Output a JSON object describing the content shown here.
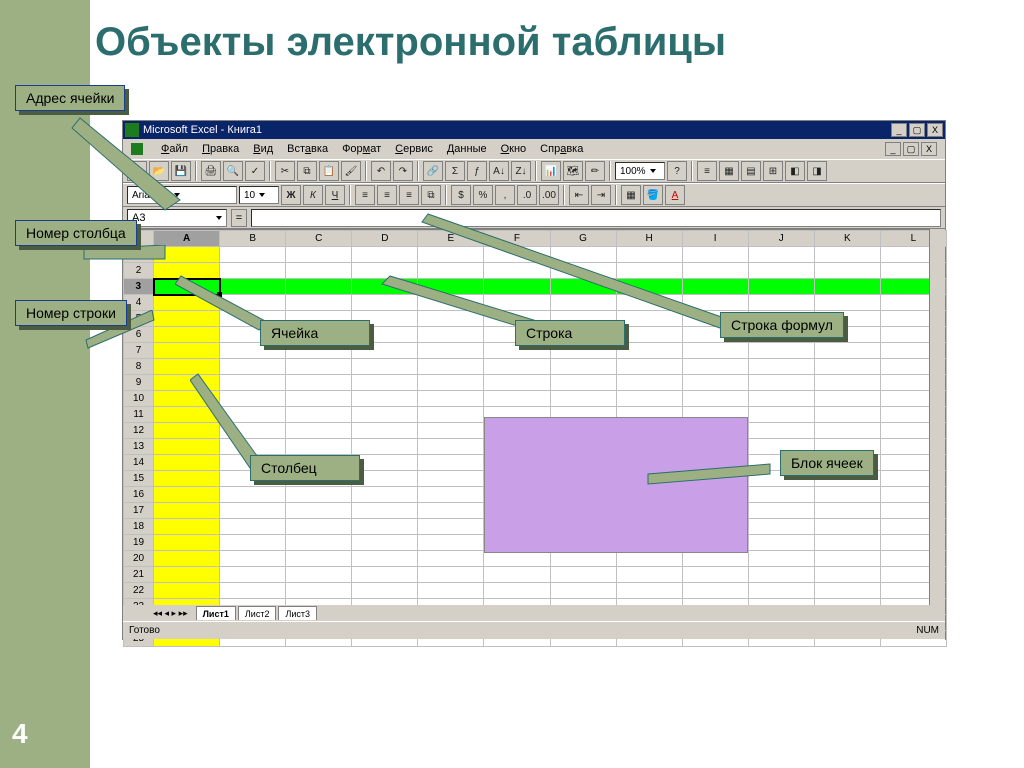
{
  "slide": {
    "title": "Объекты электронной таблицы",
    "page_number": "4"
  },
  "app": {
    "title": "Microsoft Excel - Книга1",
    "menu": [
      "Файл",
      "Правка",
      "Вид",
      "Вставка",
      "Формат",
      "Сервис",
      "Данные",
      "Окно",
      "Справка"
    ],
    "name_box_value": "A3",
    "font_name": "Arial Cyr",
    "font_size": "10",
    "zoom": "100%",
    "columns": [
      "A",
      "B",
      "C",
      "D",
      "E",
      "F",
      "G",
      "H",
      "I",
      "J",
      "K",
      "L"
    ],
    "rows": 25,
    "active_cell": "A3",
    "highlight_column": "A",
    "green_row": 3,
    "purple_block_range": "F11:I18",
    "tabs": {
      "active": "Лист1",
      "others": [
        "Лист2",
        "Лист3"
      ]
    },
    "status_left": "Готово",
    "status_right": "NUM"
  },
  "labels": {
    "cell_address": "Адрес ячейки",
    "col_number": "Номер столбца",
    "row_number": "Номер строки",
    "cell": "Ячейка",
    "row": "Строка",
    "formula_bar": "Строка формул",
    "column": "Столбец",
    "block": "Блок ячеек"
  }
}
